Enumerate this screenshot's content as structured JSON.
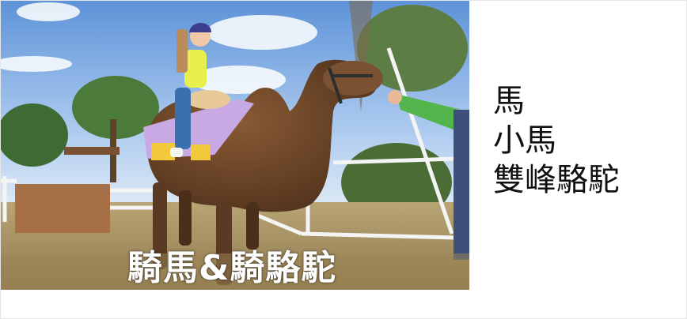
{
  "photo": {
    "overlay_title": "騎馬&騎駱駝"
  },
  "animals": {
    "items": [
      {
        "label": "馬"
      },
      {
        "label": "小馬"
      },
      {
        "label": "雙峰駱駝"
      }
    ]
  },
  "colors": {
    "sky": "#8fb6e6",
    "camel": "#6b4528",
    "grass": "#b79e6a",
    "text": "#111111",
    "overlay_text": "#ffffff"
  }
}
